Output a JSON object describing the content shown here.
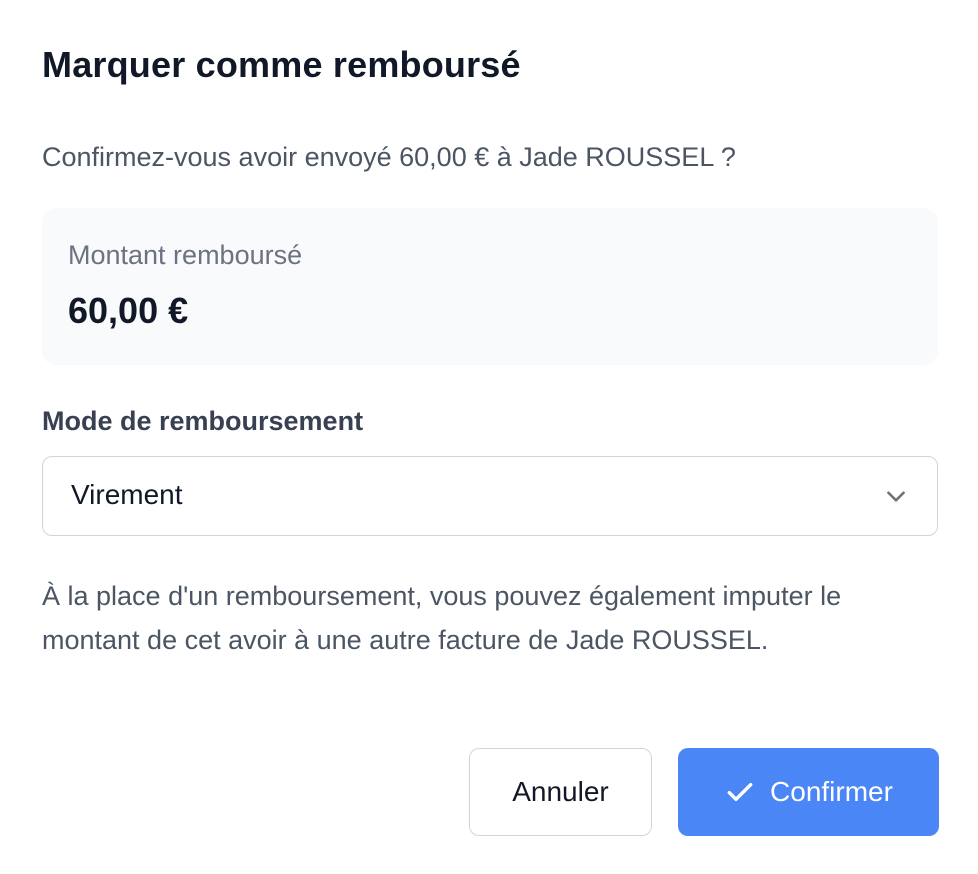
{
  "dialog": {
    "title": "Marquer comme remboursé",
    "question": "Confirmez-vous avoir envoyé 60,00 € à Jade ROUSSEL ?",
    "amount": {
      "label": "Montant remboursé",
      "value": "60,00 €"
    },
    "refund_mode": {
      "label": "Mode de remboursement",
      "selected": "Virement",
      "icon": "chevron-down-icon"
    },
    "info_text": "À la place d'un remboursement, vous pouvez également imputer le montant de cet avoir à une autre facture de Jade ROUSSEL.",
    "actions": {
      "cancel_label": "Annuler",
      "confirm_label": "Confirmer",
      "confirm_icon": "check-icon"
    }
  },
  "colors": {
    "primary": "#4b86f7",
    "text_dark": "#111827",
    "text_muted": "#4b5563",
    "panel_bg": "#f9fafb",
    "border": "#d1d5db"
  }
}
